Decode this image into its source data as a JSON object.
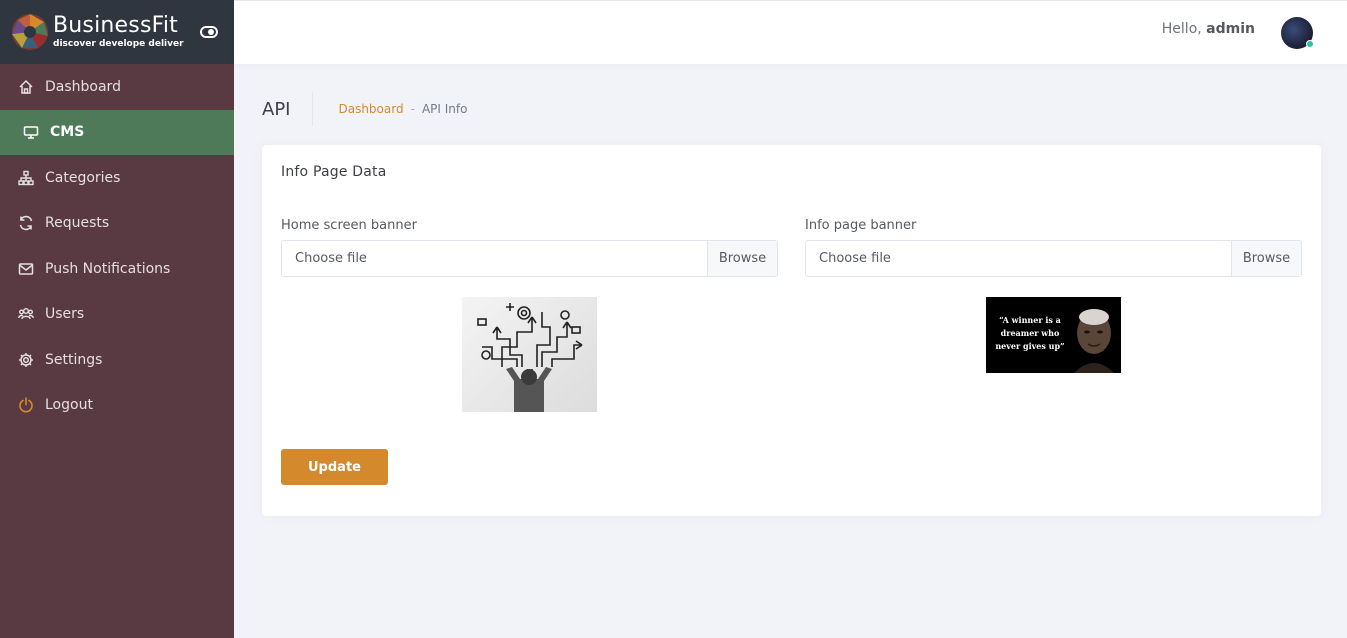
{
  "brand": {
    "name": "BusinessFit",
    "tagline": "discover develope deliver"
  },
  "sidebar": {
    "items": [
      {
        "label": "Dashboard",
        "icon": "home-icon"
      },
      {
        "label": "CMS",
        "icon": "monitor-icon",
        "active": true
      },
      {
        "label": "Categories",
        "icon": "sitemap-icon"
      },
      {
        "label": "Requests",
        "icon": "refresh-icon"
      },
      {
        "label": "Push Notifications",
        "icon": "envelope-icon"
      },
      {
        "label": "Users",
        "icon": "users-icon"
      },
      {
        "label": "Settings",
        "icon": "gear-icon"
      },
      {
        "label": "Logout",
        "icon": "power-icon"
      }
    ]
  },
  "topbar": {
    "greeting": "Hello,",
    "username": "admin",
    "status": "online"
  },
  "subheader": {
    "title": "API",
    "breadcrumb": {
      "link": "Dashboard",
      "separator": "-",
      "current": "API Info"
    }
  },
  "card": {
    "title": "Info Page Data",
    "home_banner": {
      "label": "Home screen banner",
      "placeholder": "Choose file",
      "button": "Browse"
    },
    "info_banner": {
      "label": "Info page banner",
      "placeholder": "Choose file",
      "button": "Browse"
    },
    "info_banner_quote": "“A winner is a dreamer who never gives up”",
    "submit_label": "Update"
  },
  "colors": {
    "sidebar_bg": "#5a3a42",
    "brand_bg": "#2f3640",
    "active_item": "#4e7a59",
    "accent": "#d4892c",
    "online_dot": "#34bfa3"
  }
}
